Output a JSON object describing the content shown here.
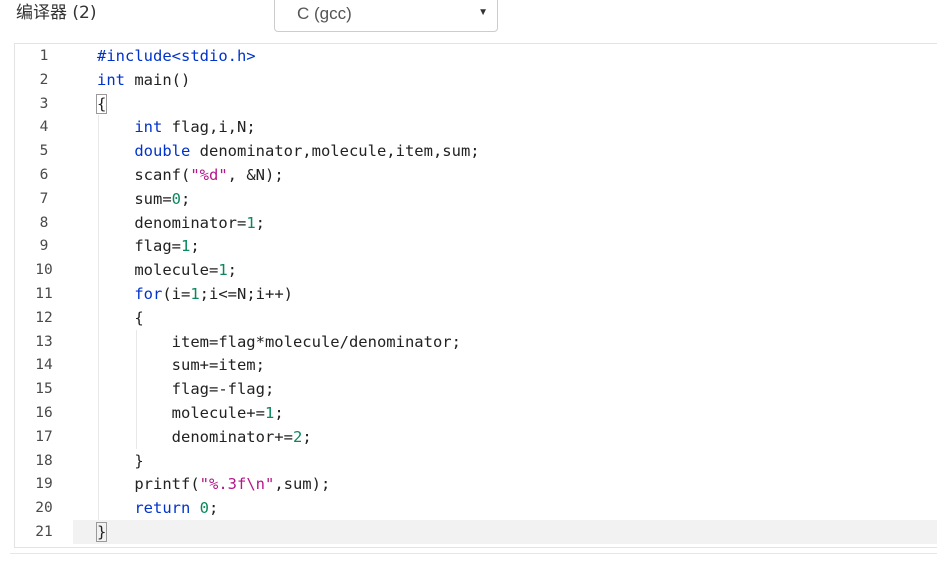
{
  "compiler": {
    "label": "编译器 (2)",
    "selected": "C (gcc)"
  },
  "editor": {
    "lines": [
      {
        "num": "1",
        "tokens": [
          {
            "t": "#include<stdio.h>",
            "c": "k"
          }
        ]
      },
      {
        "num": "2",
        "tokens": [
          {
            "t": "int",
            "c": "k"
          },
          {
            "t": " main()",
            "c": ""
          }
        ]
      },
      {
        "num": "3",
        "tokens": [
          {
            "t": "{",
            "c": "brace"
          }
        ]
      },
      {
        "num": "4",
        "tokens": [
          {
            "t": "    ",
            "c": ""
          },
          {
            "t": "int",
            "c": "k"
          },
          {
            "t": " flag,i,N;",
            "c": ""
          }
        ]
      },
      {
        "num": "5",
        "tokens": [
          {
            "t": "    ",
            "c": ""
          },
          {
            "t": "double",
            "c": "k"
          },
          {
            "t": " denominator,molecule,item,sum;",
            "c": ""
          }
        ]
      },
      {
        "num": "6",
        "tokens": [
          {
            "t": "    scanf(",
            "c": ""
          },
          {
            "t": "\"%d\"",
            "c": "s"
          },
          {
            "t": ", &N);",
            "c": ""
          }
        ]
      },
      {
        "num": "7",
        "tokens": [
          {
            "t": "    sum=",
            "c": ""
          },
          {
            "t": "0",
            "c": "n"
          },
          {
            "t": ";",
            "c": ""
          }
        ]
      },
      {
        "num": "8",
        "tokens": [
          {
            "t": "    denominator=",
            "c": ""
          },
          {
            "t": "1",
            "c": "n"
          },
          {
            "t": ";",
            "c": ""
          }
        ]
      },
      {
        "num": "9",
        "tokens": [
          {
            "t": "    flag=",
            "c": ""
          },
          {
            "t": "1",
            "c": "n"
          },
          {
            "t": ";",
            "c": ""
          }
        ]
      },
      {
        "num": "10",
        "tokens": [
          {
            "t": "    molecule=",
            "c": ""
          },
          {
            "t": "1",
            "c": "n"
          },
          {
            "t": ";",
            "c": ""
          }
        ]
      },
      {
        "num": "11",
        "tokens": [
          {
            "t": "    ",
            "c": ""
          },
          {
            "t": "for",
            "c": "k"
          },
          {
            "t": "(i=",
            "c": ""
          },
          {
            "t": "1",
            "c": "n"
          },
          {
            "t": ";i<=N;i++)",
            "c": ""
          }
        ]
      },
      {
        "num": "12",
        "tokens": [
          {
            "t": "    {",
            "c": ""
          }
        ]
      },
      {
        "num": "13",
        "tokens": [
          {
            "t": "        item=flag*molecule/denominator;",
            "c": ""
          }
        ]
      },
      {
        "num": "14",
        "tokens": [
          {
            "t": "        sum+=item;",
            "c": ""
          }
        ]
      },
      {
        "num": "15",
        "tokens": [
          {
            "t": "        flag=-flag;",
            "c": ""
          }
        ]
      },
      {
        "num": "16",
        "tokens": [
          {
            "t": "        molecule+=",
            "c": ""
          },
          {
            "t": "1",
            "c": "n"
          },
          {
            "t": ";",
            "c": ""
          }
        ]
      },
      {
        "num": "17",
        "tokens": [
          {
            "t": "        denominator+=",
            "c": ""
          },
          {
            "t": "2",
            "c": "n"
          },
          {
            "t": ";",
            "c": ""
          }
        ]
      },
      {
        "num": "18",
        "tokens": [
          {
            "t": "    }",
            "c": ""
          }
        ]
      },
      {
        "num": "19",
        "tokens": [
          {
            "t": "    printf(",
            "c": ""
          },
          {
            "t": "\"%.3f\\n\"",
            "c": "s"
          },
          {
            "t": ",sum);",
            "c": ""
          }
        ]
      },
      {
        "num": "20",
        "tokens": [
          {
            "t": "    ",
            "c": ""
          },
          {
            "t": "return",
            "c": "k"
          },
          {
            "t": " ",
            "c": ""
          },
          {
            "t": "0",
            "c": "n"
          },
          {
            "t": ";",
            "c": ""
          }
        ]
      },
      {
        "num": "21",
        "tokens": [
          {
            "t": "}",
            "c": "brace"
          }
        ],
        "active": true
      }
    ]
  },
  "colors": {
    "keyword": "#0033cc",
    "string": "#b5178a",
    "number": "#09885a",
    "active_line": "#f2f2f2"
  }
}
